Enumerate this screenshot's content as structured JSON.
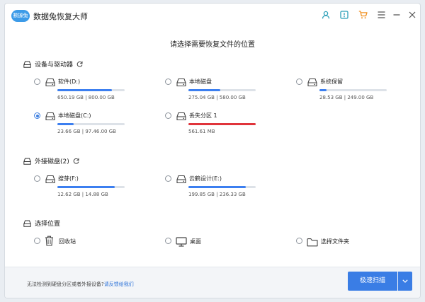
{
  "app": {
    "logo_text": "數據兔",
    "title": "数据兔恢复大师"
  },
  "heading": "请选择需要恢复文件的位置",
  "sections": {
    "drives": {
      "label": "设备与驱动器"
    },
    "external": {
      "label": "外接磁盘(2)"
    },
    "locations": {
      "label": "选择位置"
    }
  },
  "drives": [
    {
      "name": "软件(D:)",
      "used": "650.19",
      "total": "800.00 GB",
      "used_fraction": 0.81,
      "selected": false,
      "color": "#3c7ff0"
    },
    {
      "name": "本地磁盘",
      "used": "275.04",
      "total": "580.00 GB",
      "used_fraction": 0.47,
      "selected": false,
      "color": "#3c7ff0"
    },
    {
      "name": "系统保留",
      "used": "28.53",
      "total": "249.00 GB",
      "used_fraction": 0.11,
      "selected": false,
      "color": "#3c7ff0"
    },
    {
      "name": "本地磁盘(C:)",
      "used": "23.66",
      "total": "97.46.00 GB",
      "used_fraction": 0.24,
      "selected": true,
      "color": "#3c7ff0"
    },
    {
      "name": "丢失分区 1",
      "used": "561.61 MB",
      "total": "",
      "used_fraction": 1.0,
      "selected": false,
      "color": "#e0343b"
    }
  ],
  "external_drives": [
    {
      "name": "搜芽(F:)",
      "used": "12.62",
      "total": "14.88 GB",
      "used_fraction": 0.85,
      "color": "#3c7ff0"
    },
    {
      "name": "云鹤设计(E:)",
      "used": "199.85",
      "total": "236.33 GB",
      "used_fraction": 0.85,
      "color": "#3c7ff0"
    }
  ],
  "gb_unit": "GB",
  "sep": "|",
  "locations": [
    {
      "label": "回收站",
      "icon": "recycle-bin-icon"
    },
    {
      "label": "桌面",
      "icon": "desktop-icon"
    },
    {
      "label": "选择文件夹",
      "icon": "folder-icon"
    }
  ],
  "footer": {
    "text": "无法检测到硬盘分区或者外接设备?",
    "link": "请反馈给我们"
  },
  "scan_button": "极速扫描",
  "colors": {
    "accent": "#3a7de5",
    "danger": "#e0343b",
    "icon_teal": "#2a9fb8",
    "icon_orange": "#f09020"
  }
}
